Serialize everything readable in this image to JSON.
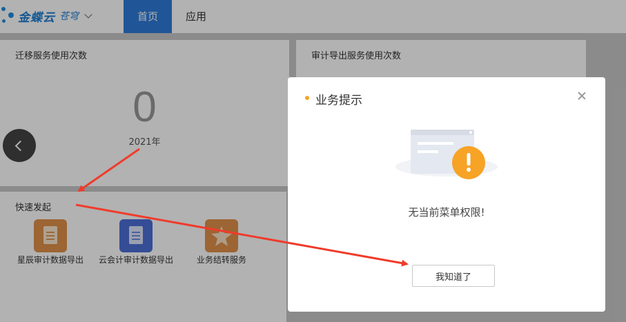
{
  "header": {
    "logo_text": "金蝶云",
    "logo_sub": "苍穹",
    "tabs": [
      {
        "label": "首页"
      },
      {
        "label": "应用"
      }
    ]
  },
  "cards": {
    "migration": {
      "title": "迁移服务使用次数",
      "count": "0",
      "year": "2021年"
    },
    "audit": {
      "title": "审计导出服务使用次数"
    }
  },
  "quick_start": {
    "title": "快速发起",
    "items": [
      {
        "label": "星辰审计数据导出",
        "icon": "document-icon",
        "color": "#e0914a"
      },
      {
        "label": "云会计审计数据导出",
        "icon": "document-icon",
        "color": "#4b6fd6"
      },
      {
        "label": "业务结转服务",
        "icon": "star-icon",
        "color": "#e0914a"
      }
    ]
  },
  "modal": {
    "title": "业务提示",
    "message": "无当前菜单权限!",
    "confirm_label": "我知道了",
    "accent_color": "#f7a326"
  },
  "annotation": {
    "arrow_color": "#f03b2b"
  }
}
